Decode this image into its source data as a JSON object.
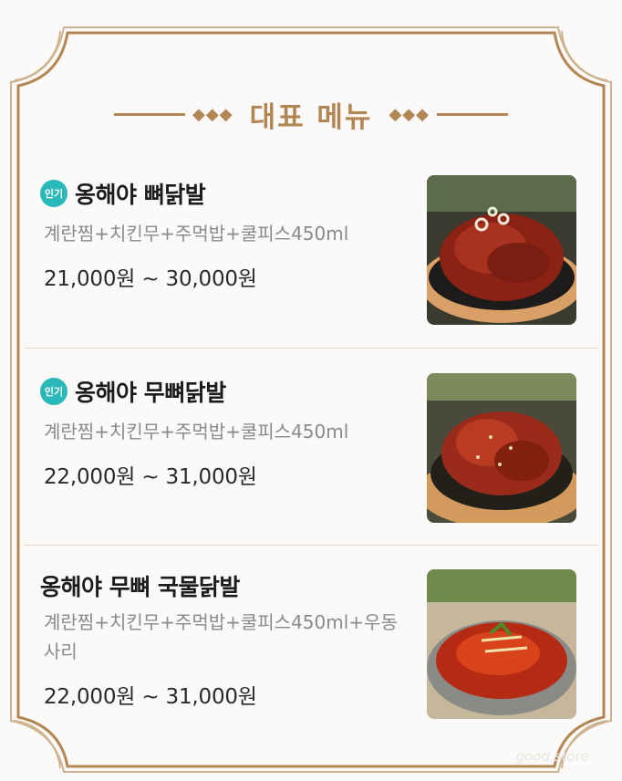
{
  "section_title": "대표 메뉴",
  "ornament_left": "◆◆◆",
  "ornament_right": "◆◆◆",
  "items": [
    {
      "badge": "인기",
      "name": "옹해야 뼈닭발",
      "desc": "계란찜+치킨무+주먹밥+쿨피스450ml",
      "price": "21,000원 ~ 30,000원",
      "image": "spicy-chicken-feet-on-bone-icon"
    },
    {
      "badge": "인기",
      "name": "옹해야 무뼈닭발",
      "desc": "계란찜+치킨무+주먹밥+쿨피스450ml",
      "price": "22,000원 ~ 31,000원",
      "image": "boneless-chicken-feet-icon"
    },
    {
      "name": "옹해야 무뼈 국물닭발",
      "desc": "계란찜+치킨무+주먹밥+쿨피스450ml+우동사리",
      "price": "22,000원 ~ 31,000원",
      "image": "chicken-feet-stew-icon"
    }
  ],
  "colors": {
    "gold": "#b38755",
    "badge": "#2bb8b8",
    "background": "#fbfaf8"
  },
  "watermark": "good store"
}
